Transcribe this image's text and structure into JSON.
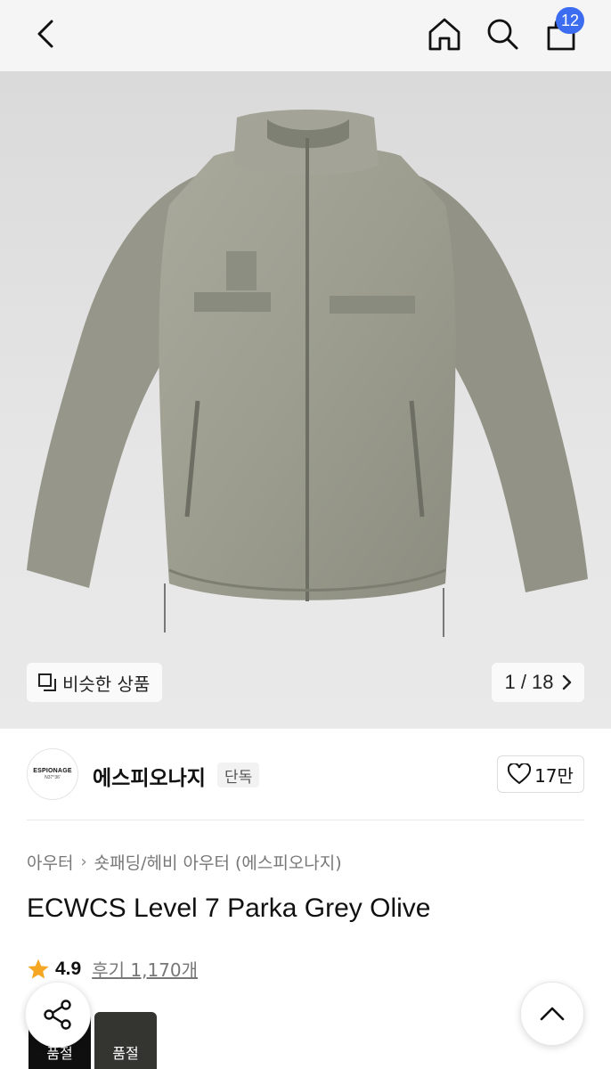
{
  "header": {
    "back_icon": "chevron-left-icon",
    "home_icon": "home-icon",
    "search_icon": "search-icon",
    "cart_icon": "shopping-bag-icon",
    "cart_count": "12",
    "badge_color": "#3c6df0"
  },
  "gallery": {
    "similar_label": "비슷한 상품",
    "similar_icon": "copy-icon",
    "page_counter": "1 / 18",
    "next_icon": "chevron-right-icon"
  },
  "brand": {
    "logo_text": "ESPIONAGE",
    "logo_sub": "N37°36'",
    "name": "에스피오나지",
    "tag": "단독",
    "like_count": "17만",
    "like_icon": "heart-icon"
  },
  "product": {
    "breadcrumb": [
      "아우터",
      "숏패딩/헤비 아우터 (에스피오나지)"
    ],
    "title": "ECWCS Level 7 Parka Grey Olive",
    "rating": "4.9",
    "reviews": "후기 1,170개",
    "star_color": "#f5a623"
  },
  "options": {
    "thumbnails": [
      {
        "label": "품절"
      },
      {
        "label": "품절"
      }
    ]
  },
  "floating": {
    "share_icon": "share-icon",
    "top_icon": "chevron-up-icon"
  }
}
